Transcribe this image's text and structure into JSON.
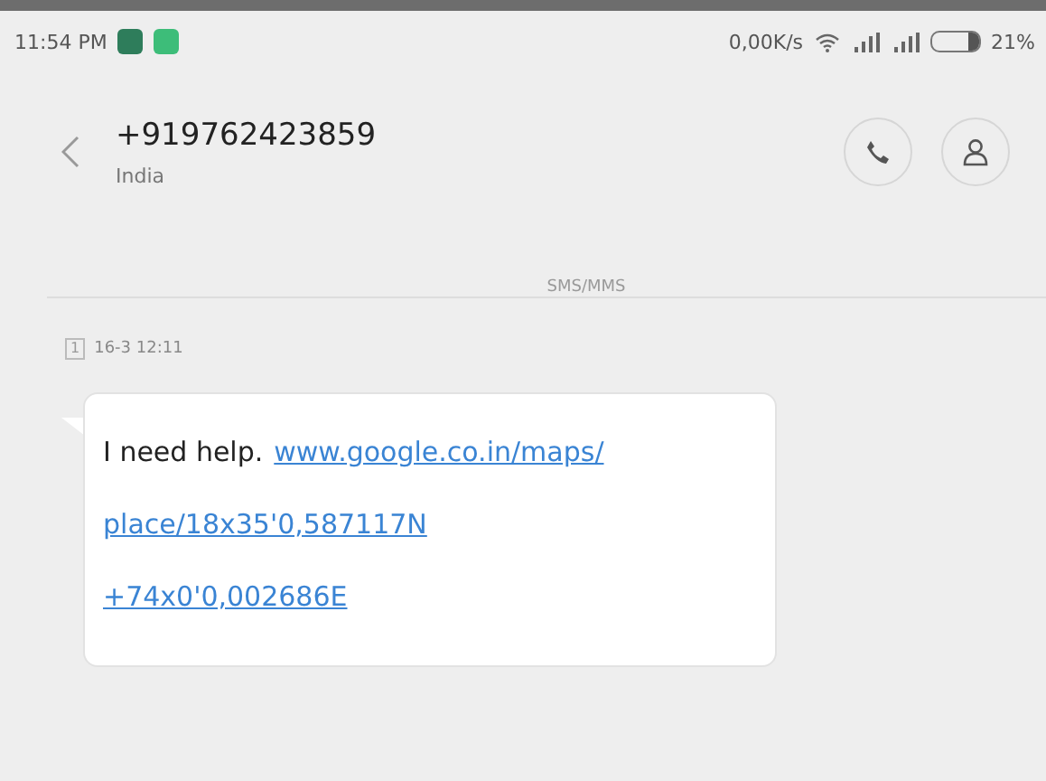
{
  "status_bar": {
    "time": "11:54 PM",
    "speed": "0,00K/s",
    "battery": "21%"
  },
  "header": {
    "title": "+919762423859",
    "subtitle": "India"
  },
  "divider_label": "SMS/MMS",
  "messages": [
    {
      "sim": "1",
      "time": "16-3 12:11",
      "text": "I need help.",
      "link_lines": [
        "www.google.co.in/maps/",
        "place/18x35'0,587117N",
        "+74x0'0,002686E"
      ]
    }
  ]
}
